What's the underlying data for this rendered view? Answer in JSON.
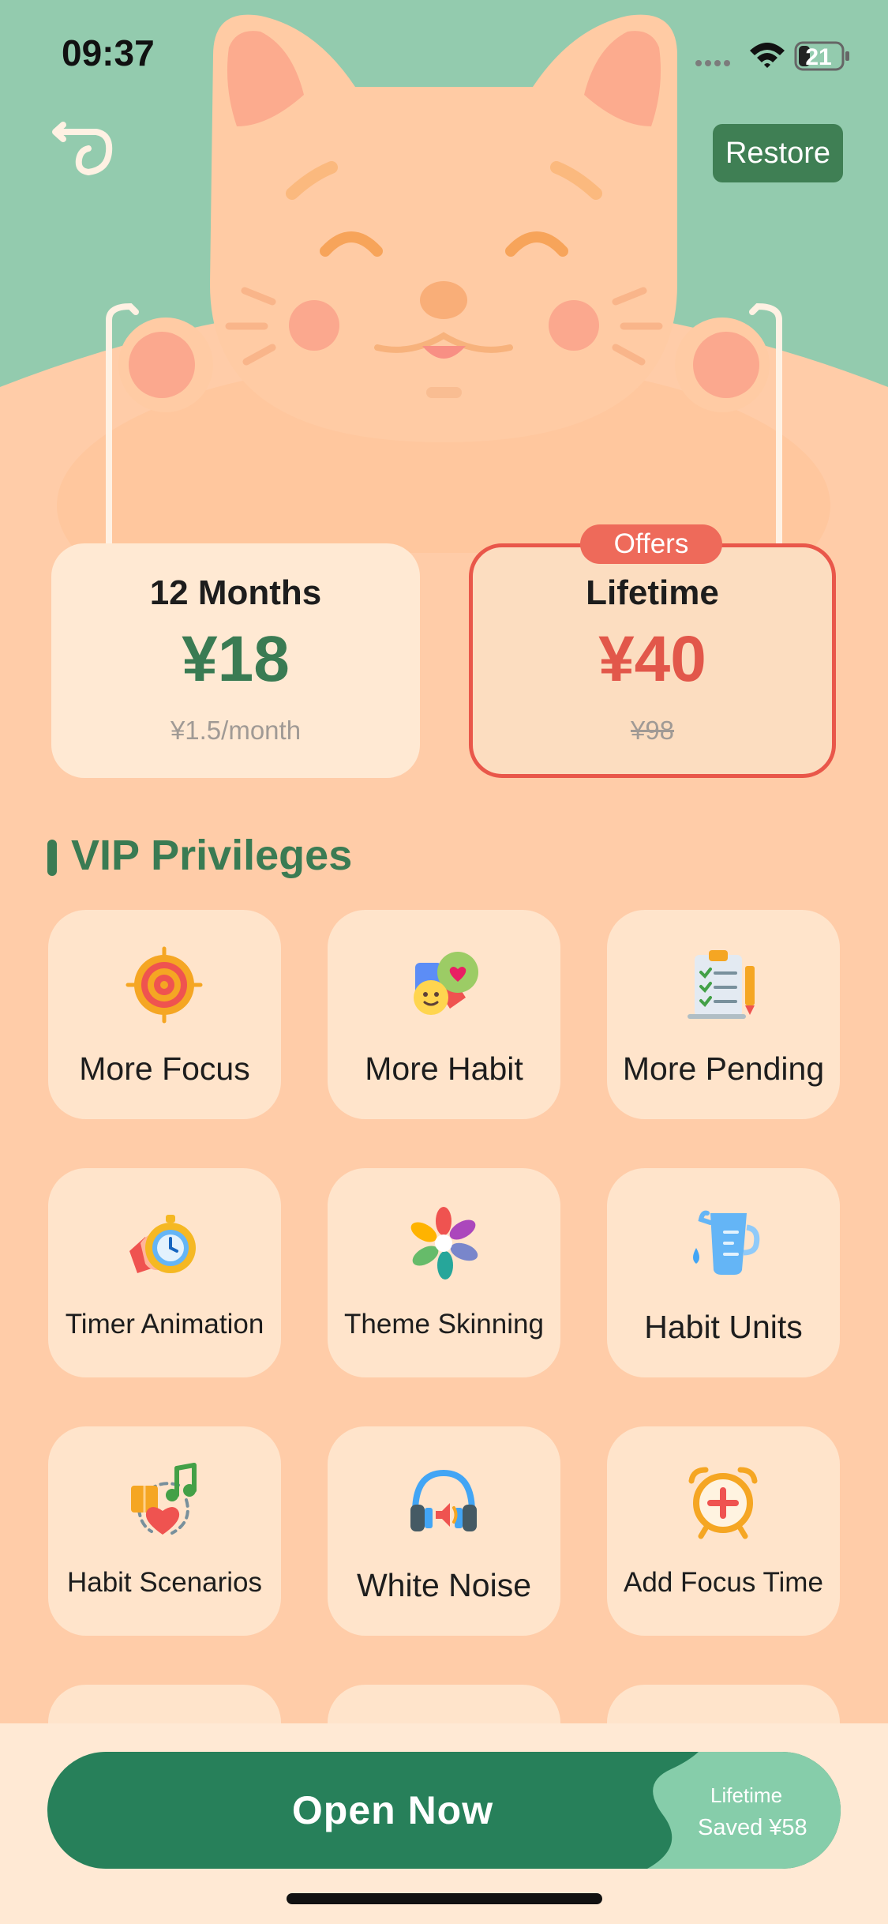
{
  "status_bar": {
    "time": "09:37",
    "battery": "21"
  },
  "header": {
    "restore_label": "Restore"
  },
  "colors": {
    "green": "#3A7B53",
    "sky": "#93CBAE",
    "peach": "#FFCCA8",
    "red": "#E9574A"
  },
  "plans": [
    {
      "title": "12 Months",
      "price": "¥18",
      "sub": "¥1.5/month"
    },
    {
      "badge": "Offers",
      "title": "Lifetime",
      "price": "¥40",
      "sub": "¥98"
    }
  ],
  "privileges": {
    "title": "VIP Privileges",
    "items": [
      {
        "label": "More Focus",
        "icon": "target-icon"
      },
      {
        "label": "More Habit",
        "icon": "habit-icon"
      },
      {
        "label": "More Pending",
        "icon": "checklist-icon"
      },
      {
        "label": "Timer Animation",
        "icon": "stopwatch-icon"
      },
      {
        "label": "Theme Skinning",
        "icon": "palette-flower-icon"
      },
      {
        "label": "Habit Units",
        "icon": "measuring-cup-icon"
      },
      {
        "label": "Habit Scenarios",
        "icon": "scenario-icon"
      },
      {
        "label": "White Noise",
        "icon": "headphones-icon"
      },
      {
        "label": "Add Focus Time",
        "icon": "alarm-plus-icon"
      }
    ]
  },
  "cta": {
    "label": "Open Now",
    "note_line1": "Lifetime",
    "note_line2": "Saved ¥58"
  }
}
